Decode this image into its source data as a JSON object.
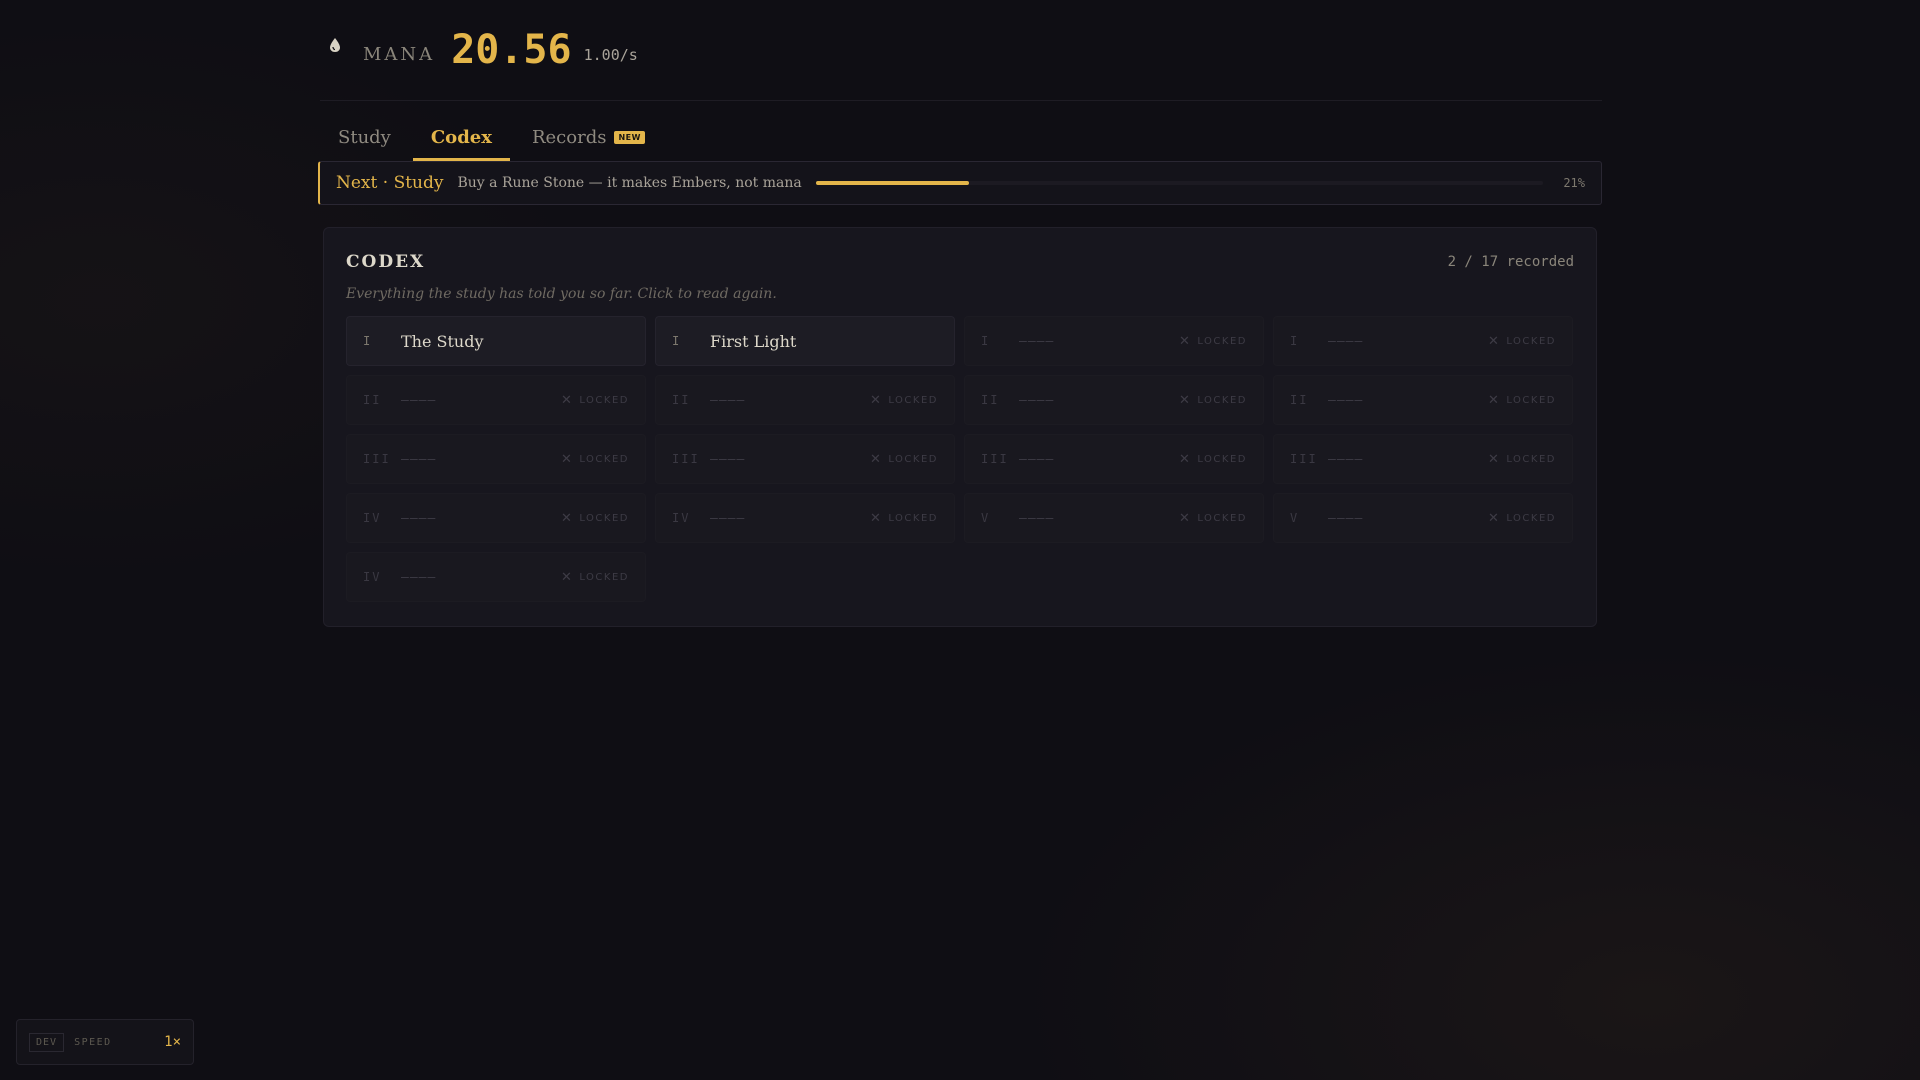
{
  "colors": {
    "accent": "#e3b54a",
    "background": "#0f0e14",
    "panel": "#17161e"
  },
  "header": {
    "icon": "mana-drop-icon",
    "mana_label": "MANA",
    "mana_value": "20.56",
    "mana_rate": "1.00/s"
  },
  "tabs": [
    {
      "label": "Study",
      "active": false
    },
    {
      "label": "Codex",
      "active": true
    },
    {
      "label": "Records",
      "active": false,
      "badge": "NEW"
    }
  ],
  "next": {
    "title": "Next · Study",
    "description": "Buy a Rune Stone — it makes Embers, not mana",
    "progress_percent": 21,
    "progress_label": "21%"
  },
  "codex": {
    "title": "CODEX",
    "count": "2 / 17 recorded",
    "subtitle": "Everything the study has told you so far. Click to read again.",
    "locked_label": "LOCKED",
    "locked_placeholder": "————",
    "entries": [
      {
        "num": "I",
        "name": "The Study",
        "locked": false
      },
      {
        "num": "I",
        "name": "First Light",
        "locked": false
      },
      {
        "num": "I",
        "locked": true
      },
      {
        "num": "I",
        "locked": true
      },
      {
        "num": "II",
        "locked": true
      },
      {
        "num": "II",
        "locked": true
      },
      {
        "num": "II",
        "locked": true
      },
      {
        "num": "II",
        "locked": true
      },
      {
        "num": "III",
        "locked": true
      },
      {
        "num": "III",
        "locked": true
      },
      {
        "num": "III",
        "locked": true
      },
      {
        "num": "III",
        "locked": true
      },
      {
        "num": "IV",
        "locked": true
      },
      {
        "num": "IV",
        "locked": true
      },
      {
        "num": "V",
        "locked": true
      },
      {
        "num": "V",
        "locked": true
      },
      {
        "num": "IV",
        "locked": true
      }
    ]
  },
  "dev": {
    "tag": "DEV",
    "label": "SPEED",
    "speed": "1×"
  }
}
